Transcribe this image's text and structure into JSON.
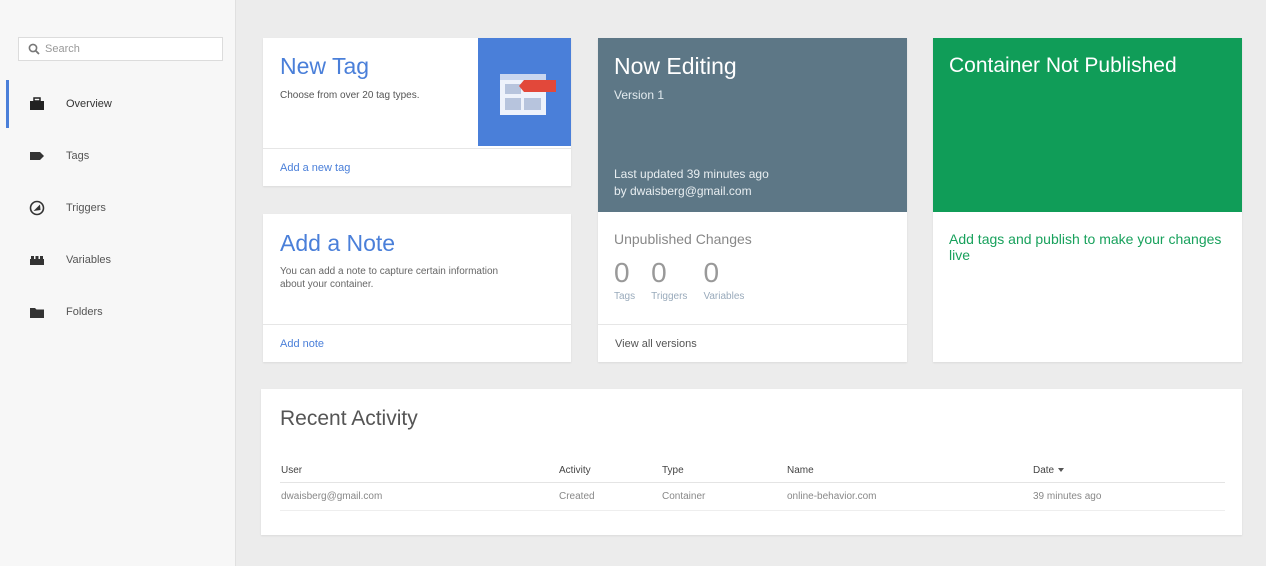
{
  "sidebar": {
    "search_placeholder": "Search",
    "items": [
      {
        "label": "Overview",
        "icon": "briefcase-icon",
        "active": true
      },
      {
        "label": "Tags",
        "icon": "tag-icon"
      },
      {
        "label": "Triggers",
        "icon": "trigger-icon"
      },
      {
        "label": "Variables",
        "icon": "blocks-icon"
      },
      {
        "label": "Folders",
        "icon": "folder-icon"
      }
    ]
  },
  "new_tag": {
    "title": "New Tag",
    "description": "Choose from over 20 tag types.",
    "link": "Add a new tag",
    "accent": "#4a7fd9"
  },
  "add_note": {
    "title": "Add a Note",
    "description": "You can add a note to capture certain information about your container.",
    "link": "Add note"
  },
  "now_editing": {
    "title": "Now Editing",
    "version": "Version 1",
    "updated": "Last updated 39 minutes ago",
    "by": "by dwaisberg@gmail.com",
    "header_color": "#5d7786",
    "unpublished_title": "Unpublished Changes",
    "counts": [
      {
        "value": "0",
        "label": "Tags"
      },
      {
        "value": "0",
        "label": "Triggers"
      },
      {
        "value": "0",
        "label": "Variables"
      }
    ],
    "link": "View all versions"
  },
  "not_published": {
    "title": "Container Not Published",
    "message": "Add tags and publish to make your changes live",
    "header_color": "#109d58"
  },
  "recent_activity": {
    "title": "Recent Activity",
    "columns": [
      "User",
      "Activity",
      "Type",
      "Name",
      "Date"
    ],
    "rows": [
      [
        "dwaisberg@gmail.com",
        "Created",
        "Container",
        "online-behavior.com",
        "39 minutes ago"
      ]
    ]
  }
}
